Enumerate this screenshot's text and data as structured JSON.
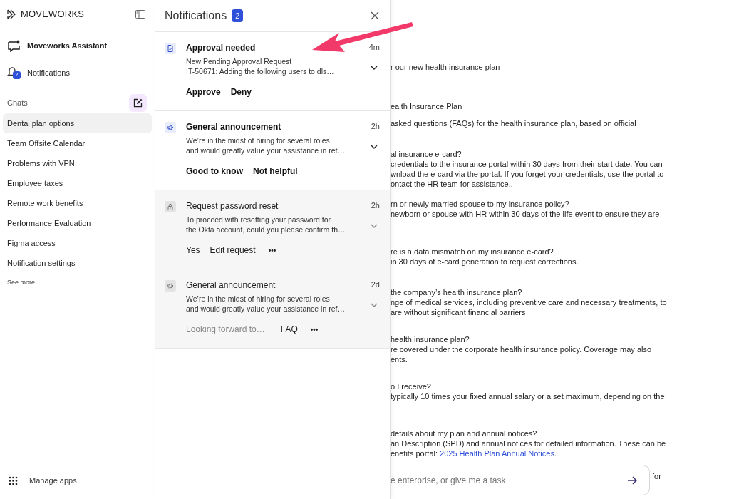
{
  "sidebar": {
    "brand": "MOVEWORKS",
    "nav": [
      {
        "kind": "assistant",
        "label": "Moveworks Assistant"
      },
      {
        "kind": "notifications",
        "label": "Notifications",
        "badge": "2"
      }
    ],
    "chats_label": "Chats",
    "chats": [
      {
        "label": "Dental plan options",
        "selected": true
      },
      {
        "label": "Team Offsite Calendar",
        "selected": false
      },
      {
        "label": "Problems with VPN",
        "selected": false
      },
      {
        "label": "Employee taxes",
        "selected": false
      },
      {
        "label": "Remote work benefits",
        "selected": false
      },
      {
        "label": "Performance Evaluation",
        "selected": false
      },
      {
        "label": "Figma access",
        "selected": false
      },
      {
        "label": "Notification settings",
        "selected": false
      }
    ],
    "see_more": "See more",
    "manage_apps": "Manage apps"
  },
  "notifications": {
    "title": "Notifications",
    "count": "2",
    "items": [
      {
        "kind": "approval",
        "unread": true,
        "title": "Approval needed",
        "time": "4m",
        "body": [
          "New Pending Approval Request",
          "IT-50671: Adding the following users to dls…"
        ],
        "actions": [
          {
            "kind": "button",
            "label": "Approve"
          },
          {
            "kind": "button",
            "label": "Deny"
          }
        ]
      },
      {
        "kind": "announcement",
        "unread": true,
        "title": "General announcement",
        "time": "2h",
        "body": [
          "We’re in the midst of hiring for several roles",
          "and would greatly value your assistance in ref…"
        ],
        "actions": [
          {
            "kind": "button",
            "label": "Good to know"
          },
          {
            "kind": "button",
            "label": "Not helpful"
          }
        ]
      },
      {
        "kind": "lock",
        "unread": false,
        "title": "Request password reset",
        "time": "2h",
        "body": [
          "To proceed with resetting your password for",
          "the Okta account, could you please confirm th…"
        ],
        "actions": [
          {
            "kind": "button",
            "label": "Yes"
          },
          {
            "kind": "button",
            "label": "Edit request"
          },
          {
            "kind": "more",
            "label": "•••"
          }
        ]
      },
      {
        "kind": "announcement",
        "unread": false,
        "title": "General announcement",
        "time": "2d",
        "body": [
          "We’re in the midst of hiring for several roles",
          "and would greatly value your assistance in ref…"
        ],
        "actions": [
          {
            "kind": "muted",
            "label": "Looking forward to…"
          },
          {
            "kind": "button",
            "label": "FAQ"
          },
          {
            "kind": "more",
            "label": "•••"
          }
        ]
      }
    ]
  },
  "chat": {
    "blocks": [
      [
        {
          "text": "r our new health insurance plan"
        }
      ],
      [
        {
          "text": "ealth Insurance Plan"
        }
      ],
      [
        {
          "text": "asked questions (FAQs) for the health insurance plan, based on official"
        }
      ],
      [
        {
          "text": "al insurance e-card?"
        },
        {
          "text": "credentials to the insurance portal within 30 days from their start date. You can"
        },
        {
          "text": "wnload the e-card via the portal. If you forget your credentials, use the portal to"
        },
        {
          "text": "ontact the HR team for assistance.."
        }
      ],
      [
        {
          "text": "rn or newly married spouse to my insurance policy?"
        },
        {
          "text": "newborn or spouse with HR within 30 days of the life event to ensure they are"
        }
      ],
      [
        {
          "text": "re is a data mismatch on my insurance e-card?"
        },
        {
          "text": "in 30 days of e-card generation to request corrections."
        }
      ],
      [
        {
          "text": "the company’s health insurance plan?"
        },
        {
          "text": "nge of medical services, including preventive care and necessary treatments, to"
        },
        {
          "text": "are without significant financial barriers"
        }
      ],
      [
        {
          "text": "health insurance plan?"
        },
        {
          "text": "re covered under the corporate health insurance policy. Coverage may also"
        },
        {
          "text": "ents."
        }
      ],
      [
        {
          "text": "o I receive?"
        },
        {
          "text": "typically 10 times your fixed annual salary or a set maximum, depending on the"
        }
      ],
      [
        {
          "text": "details about my plan and annual notices?"
        },
        {
          "text": "an Description (SPD) and annual notices for detailed information. These can be"
        },
        {
          "text": "enefits portal: ",
          "link": "2025 Health Plan Annual Notices",
          "after": "."
        }
      ]
    ],
    "composer": {
      "placeholder": "e enterprise, or give me a task"
    },
    "trailing_text": "for"
  }
}
